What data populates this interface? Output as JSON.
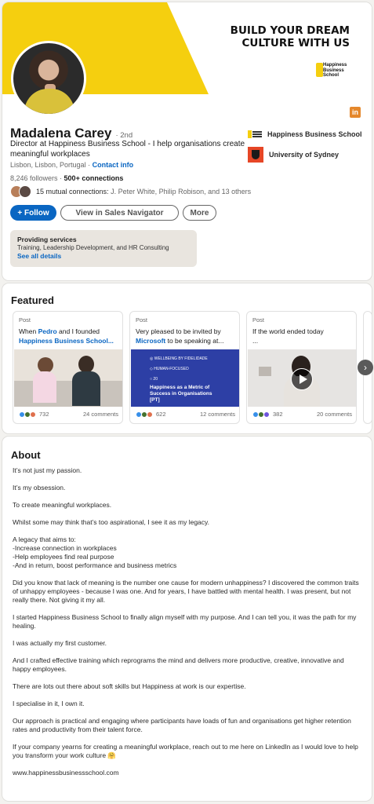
{
  "banner": {
    "headline_line1": "BUILD YOUR DREAM",
    "headline_line2": "CULTURE WITH US",
    "logo_text_line1": "Happiness",
    "logo_text_line2": "Business",
    "logo_text_line3": "School",
    "badge": "in"
  },
  "profile": {
    "name": "Madalena Carey",
    "degree": "· 2nd",
    "headline": "Director at Happiness Business School - I help organisations create meaningful workplaces",
    "location": "Lisbon, Lisbon, Portugal",
    "location_sep": " · ",
    "contact_info": "Contact info",
    "followers": "8,246 followers",
    "stats_sep": " · ",
    "connections": "500+ connections",
    "mutual_count": "15 mutual connections:",
    "mutual_names": " J. Peter White, Philip Robison, and 13 others",
    "buttons": {
      "follow": "+ Follow",
      "sales_nav": "View in Sales Navigator",
      "more": "More"
    },
    "providing": {
      "title": "Providing services",
      "detail": "Training, Leadership Development, and HR Consulting",
      "link": "See all details"
    },
    "orgs": [
      {
        "name": "Happiness Business School"
      },
      {
        "name": "University of Sydney"
      }
    ]
  },
  "featured": {
    "title": "Featured",
    "items": [
      {
        "label": "Post",
        "text_pre": "When ",
        "link1": "Pedro",
        "text_mid": " and I founded",
        "link2": "Happiness Business School...",
        "reactions": "732",
        "comments": "24 comments"
      },
      {
        "label": "Post",
        "text_pre": "Very pleased to be invited by",
        "link1": "Microsoft",
        "text_mid": " to be speaking at...",
        "reactions": "622",
        "comments": "12 comments",
        "slide": {
          "row1": "WELLBEING BY FIDELIDADE",
          "row2": "HUMAN-FOCUSED",
          "row3": "20",
          "title": "Happiness as a Metric of Success in Organisations [PT]"
        }
      },
      {
        "label": "Post",
        "text_pre": "If the world ended today",
        "text_mid": "...",
        "reactions": "382",
        "comments": "20 comments"
      }
    ]
  },
  "about": {
    "title": "About",
    "paragraphs": [
      "It’s not just my passion.",
      "It’s my obsession.",
      "To create meaningful workplaces.",
      "Whilst some may think that’s too aspirational, I see it as my legacy.",
      "A legacy that aims to:\n-Increase connection in workplaces\n-Help employees find real purpose\n-And in return, boost performance and business metrics",
      "Did you know that lack of meaning is the number one cause for modern unhappiness? I discovered the common traits of unhappy employees - because I was one. And for years, I have battled with mental health. I was present, but not really there. Not giving it my all.",
      "I started Happiness Business School to finally align myself with my purpose. And I can tell you, it was the path for my healing.",
      "I was actually my first customer.",
      "And I crafted effective training which reprograms the mind and delivers more productive, creative, innovative and happy employees.",
      "There are lots out there about soft skills but Happiness at work is our expertise.",
      "I specialise in it, I own it.",
      "Our approach is practical and engaging where participants have loads of fun and organisations get higher retention rates and productivity from their talent force.",
      "If your company yearns for creating a meaningful workplace, reach out to me here on LinkedIn as I would love to help you transform your work culture 🤗",
      "www.happinessbusinessschool.com"
    ]
  },
  "colors": {
    "accent": "#0a66c2",
    "banner_yellow": "#f5cf0f",
    "page_bg": "#f3f2ef"
  }
}
